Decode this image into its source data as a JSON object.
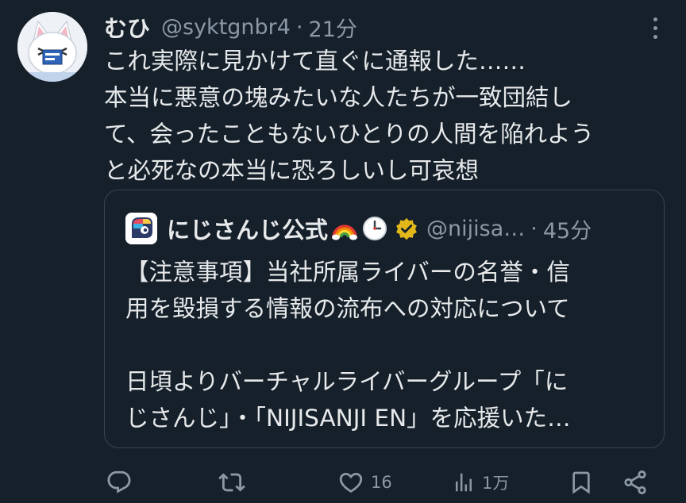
{
  "tweet": {
    "author_name": "むひ",
    "handle": "@syktgnbr4",
    "separator": "·",
    "time": "21分",
    "text_lines": [
      "これ実際に見かけて直ぐに通報した……",
      "本当に悪意の塊みたいな人たちが一致団結し",
      "て、会ったこともないひとりの人間を陥れよう",
      "と必死なの本当に恐ろしいし可哀想"
    ]
  },
  "quote": {
    "author_name": "にじさんじ公式",
    "emojis": [
      "rainbow-emoji",
      "clock-emoji"
    ],
    "verified_badge": "gold-verified-badge",
    "handle": "@nijisa…",
    "separator": "·",
    "time": "45分",
    "text_lines": [
      "【注意事項】当社所属ライバーの名誉・信",
      "用を毀損する情報の流布への対応について",
      "",
      "日頃よりバーチャルライバーグループ「に",
      "じさんじ」・「NIJISANJI EN」を応援いた…"
    ]
  },
  "actions": {
    "reply": {
      "icon": "reply-icon",
      "count": ""
    },
    "retweet": {
      "icon": "retweet-icon",
      "count": ""
    },
    "like": {
      "icon": "heart-icon",
      "count": "16"
    },
    "views": {
      "icon": "views-icon",
      "count": "1万"
    },
    "bookmark": {
      "icon": "bookmark-icon"
    },
    "share": {
      "icon": "share-icon"
    }
  },
  "colors": {
    "background": "#15202b",
    "text_primary": "#e7e9ea",
    "text_secondary": "#8b98a5",
    "border": "#38444d",
    "verified_gold": "#e2b719"
  }
}
